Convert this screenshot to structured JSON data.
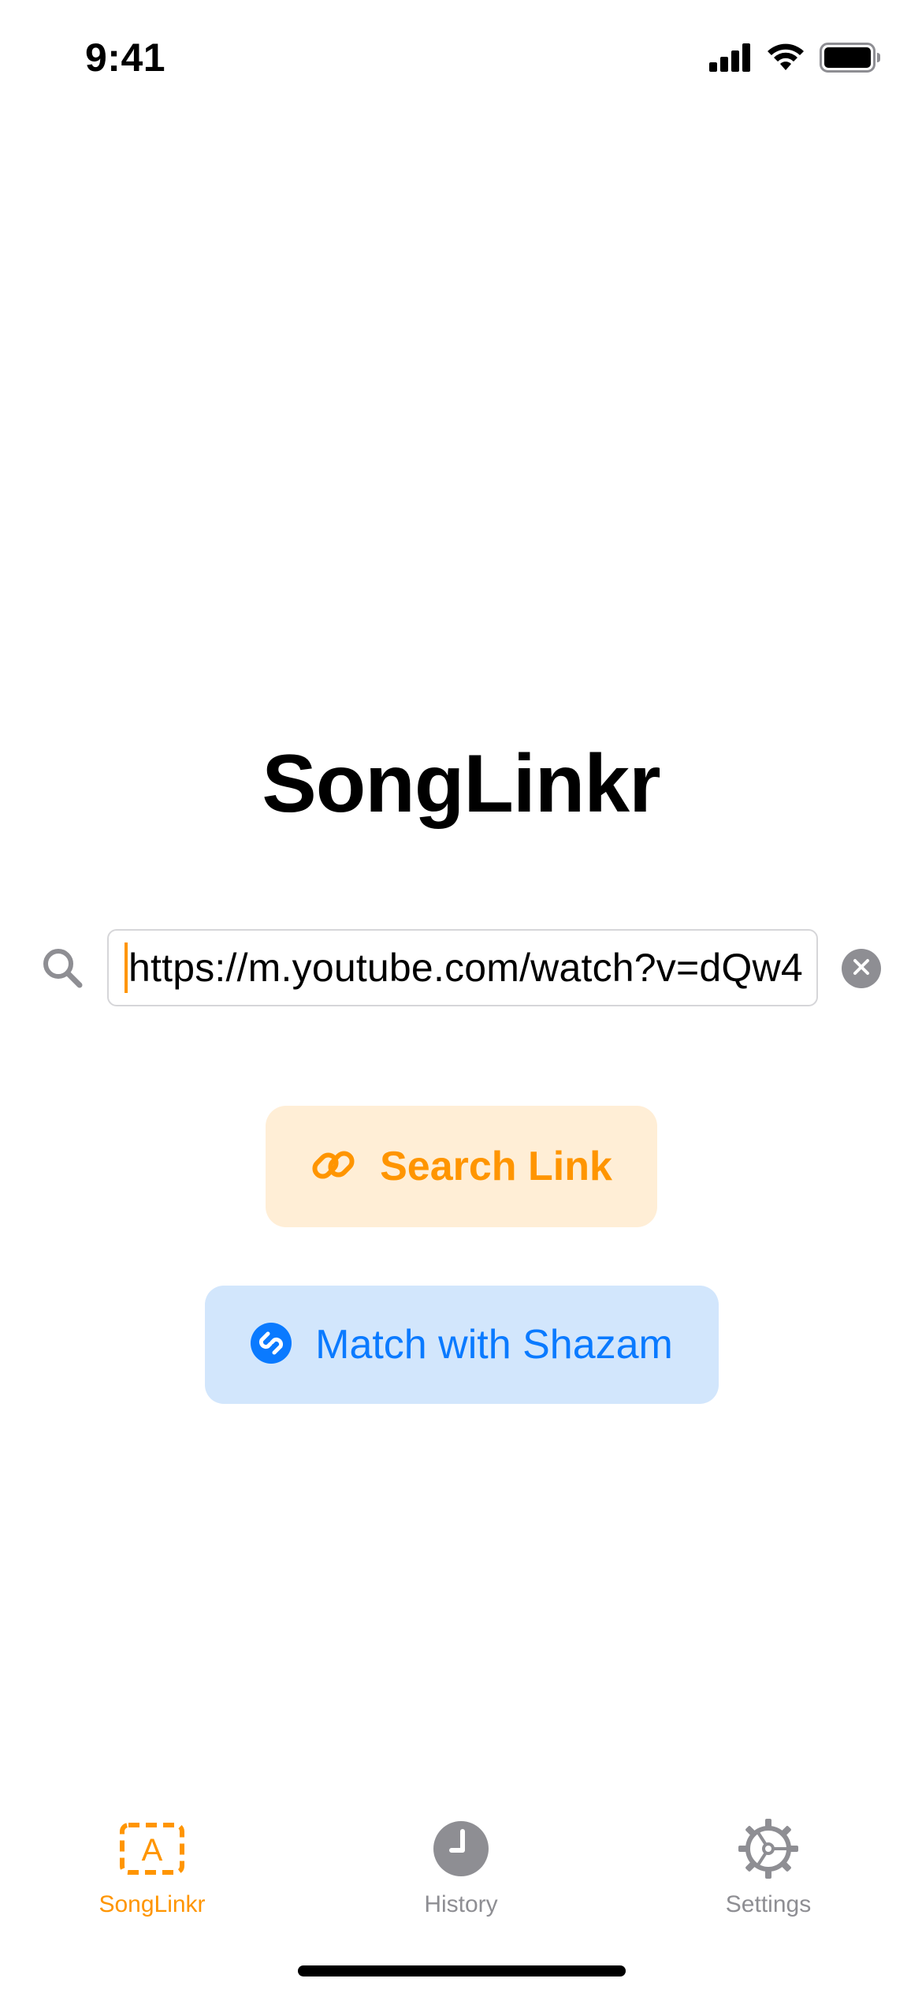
{
  "status_bar": {
    "time": "9:41"
  },
  "app": {
    "title": "SongLinkr"
  },
  "search": {
    "icon": "magnifying-glass-icon",
    "url_value": "https://m.youtube.com/watch?v=dQw4",
    "clear_icon": "xmark-circle-icon"
  },
  "actions": {
    "search_link": {
      "label": "Search Link",
      "icon": "link-icon"
    },
    "match_shazam": {
      "label": "Match with Shazam",
      "icon": "shazam-icon"
    }
  },
  "tabs": [
    {
      "label": "SongLinkr",
      "icon": "app-store-tab-icon",
      "selected": true
    },
    {
      "label": "History",
      "icon": "clock-icon",
      "selected": false
    },
    {
      "label": "Settings",
      "icon": "gear-icon",
      "selected": false
    }
  ],
  "colors": {
    "accent": "#ff9500",
    "accent_bg": "#ffeed6",
    "shazam_blue": "#0a7aff",
    "shazam_bg": "#d2e6fc",
    "inactive_tab": "#8e8e93"
  }
}
